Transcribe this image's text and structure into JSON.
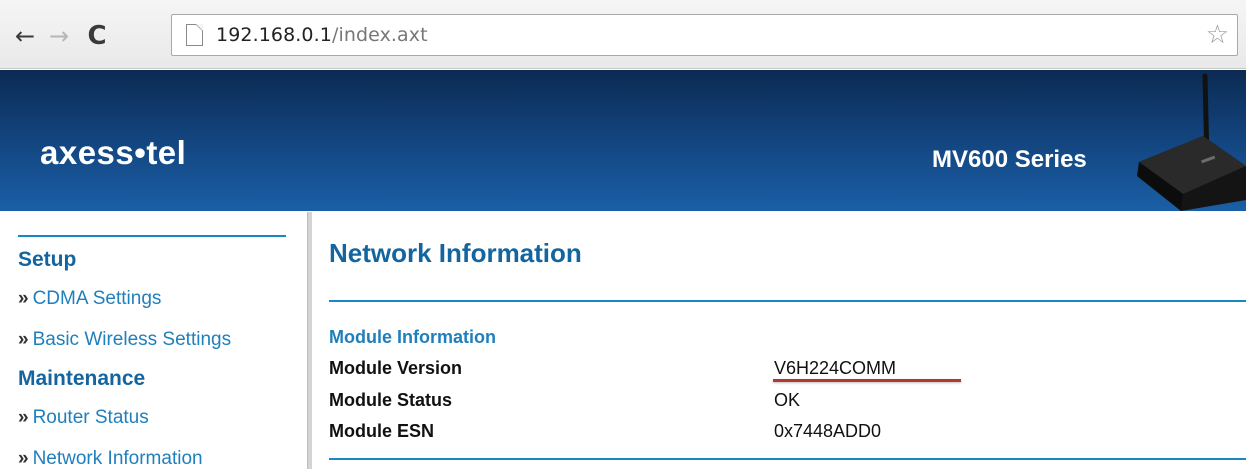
{
  "browser": {
    "back_icon": "←",
    "forward_icon": "→",
    "reload_icon": "C",
    "url_host": "192.168.0.1",
    "url_path": "/index.axt",
    "star_icon": "☆"
  },
  "header": {
    "logo": "axess•tel",
    "series": "MV600 Series"
  },
  "sidebar": {
    "sections": [
      {
        "heading": "Setup",
        "items": [
          {
            "label": "CDMA Settings"
          },
          {
            "label": "Basic Wireless Settings"
          }
        ]
      },
      {
        "heading": "Maintenance",
        "items": [
          {
            "label": "Router Status"
          },
          {
            "label": "Network Information"
          }
        ]
      }
    ],
    "bullet": "»"
  },
  "main": {
    "title": "Network Information",
    "section_title": "Module Information",
    "rows": [
      {
        "label": "Module Version",
        "value": "V6H224COMM"
      },
      {
        "label": "Module Status",
        "value": "OK"
      },
      {
        "label": "Module ESN",
        "value": "0x7448ADD0"
      }
    ]
  },
  "colors": {
    "banner": "#12427b",
    "heading": "#14659f",
    "link": "#1f7fbd",
    "rule": "#1a87c5",
    "annotation": "#b03a2e"
  }
}
